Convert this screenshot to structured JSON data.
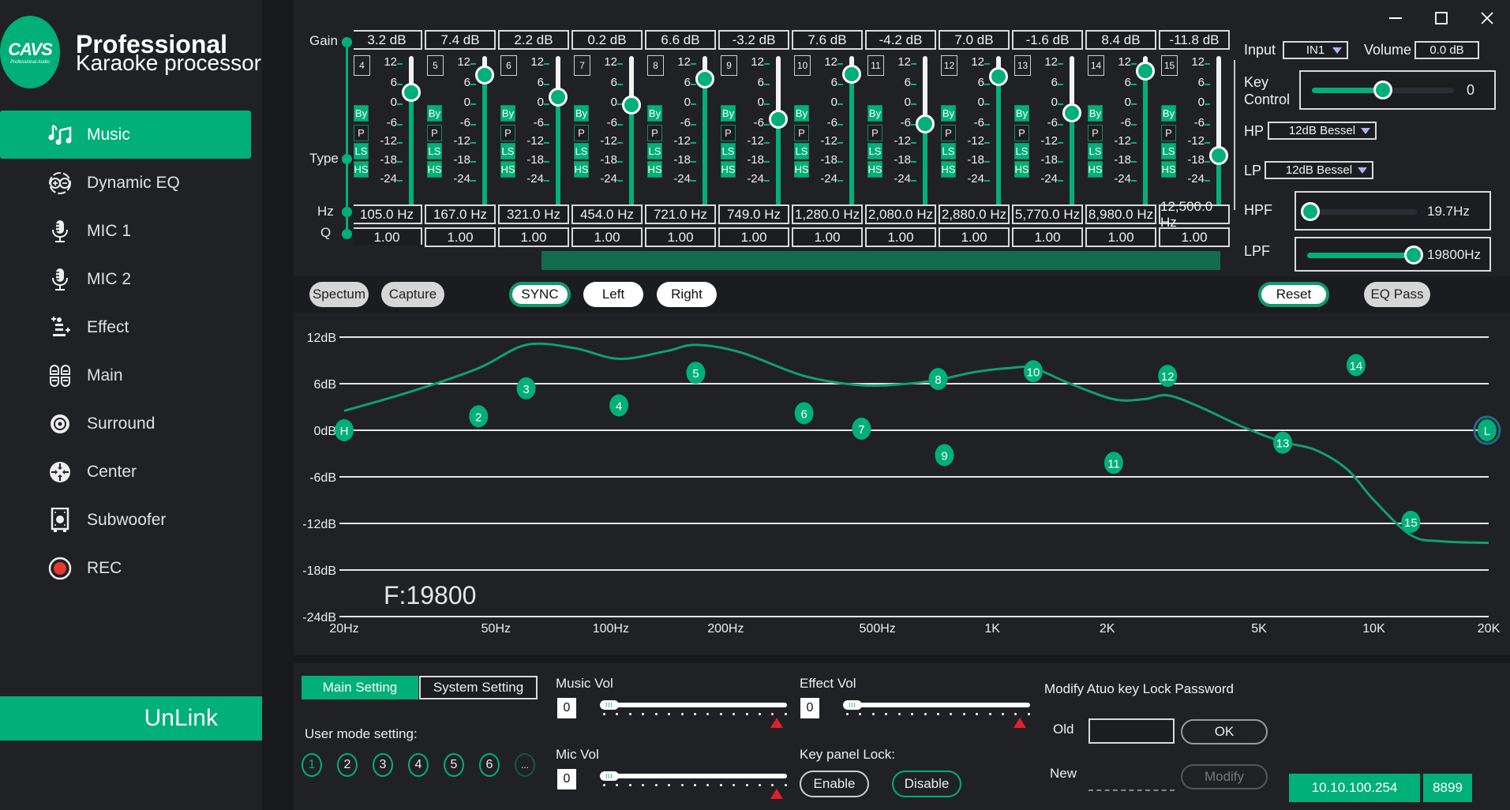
{
  "app": {
    "brand": "CAVS",
    "brand_sub": "Professional Audio",
    "title_line1": "Professional",
    "title_line2": "Karaoke processor"
  },
  "window_controls": {
    "minimize": "—",
    "maximize": "☐",
    "close": "✕"
  },
  "sidebar": {
    "items": [
      {
        "label": "Music",
        "icon": "music-notes-icon",
        "active": true
      },
      {
        "label": "Dynamic EQ",
        "icon": "dynamic-eq-icon",
        "active": false
      },
      {
        "label": "MIC 1",
        "icon": "microphone-icon",
        "active": false
      },
      {
        "label": "MIC 2",
        "icon": "microphone-icon",
        "active": false
      },
      {
        "label": "Effect",
        "icon": "effect-sparkle-icon",
        "active": false
      },
      {
        "label": "Main",
        "icon": "main-quad-icon",
        "active": false
      },
      {
        "label": "Surround",
        "icon": "speaker-surround-icon",
        "active": false
      },
      {
        "label": "Center",
        "icon": "center-arrows-icon",
        "active": false
      },
      {
        "label": "Subwoofer",
        "icon": "subwoofer-icon",
        "active": false
      },
      {
        "label": "REC",
        "icon": "record-icon",
        "active": false
      }
    ],
    "unlink_label": "UnLink"
  },
  "eq": {
    "row_labels": {
      "gain": "Gain",
      "type": "Type",
      "hz": "Hz",
      "q": "Q"
    },
    "scale_ticks": [
      "12",
      "6",
      "0",
      "-6",
      "-12",
      "-18",
      "-24"
    ],
    "type_buttons": [
      "By",
      "P",
      "LS",
      "HS"
    ],
    "bands": [
      {
        "num": "4",
        "gain": "3.2 dB",
        "gain_value": 3.2,
        "freq": "105.0 Hz",
        "q": "1.00",
        "partial": true
      },
      {
        "num": "5",
        "gain": "7.4 dB",
        "gain_value": 7.4,
        "freq": "167.0 Hz",
        "q": "1.00"
      },
      {
        "num": "6",
        "gain": "2.2 dB",
        "gain_value": 2.2,
        "freq": "321.0 Hz",
        "q": "1.00"
      },
      {
        "num": "7",
        "gain": "0.2 dB",
        "gain_value": 0.2,
        "freq": "454.0 Hz",
        "q": "1.00"
      },
      {
        "num": "8",
        "gain": "6.6 dB",
        "gain_value": 6.6,
        "freq": "721.0 Hz",
        "q": "1.00"
      },
      {
        "num": "9",
        "gain": "-3.2 dB",
        "gain_value": -3.2,
        "freq": "749.0 Hz",
        "q": "1.00"
      },
      {
        "num": "10",
        "gain": "7.6 dB",
        "gain_value": 7.6,
        "freq": "1,280.0 Hz",
        "q": "1.00"
      },
      {
        "num": "11",
        "gain": "-4.2 dB",
        "gain_value": -4.2,
        "freq": "2,080.0 Hz",
        "q": "1.00"
      },
      {
        "num": "12",
        "gain": "7.0 dB",
        "gain_value": 7.0,
        "freq": "2,880.0 Hz",
        "q": "1.00"
      },
      {
        "num": "13",
        "gain": "-1.6 dB",
        "gain_value": -1.6,
        "freq": "5,770.0 Hz",
        "q": "1.00"
      },
      {
        "num": "14",
        "gain": "8.4 dB",
        "gain_value": 8.4,
        "freq": "8,980.0 Hz",
        "q": "1.00"
      },
      {
        "num": "15",
        "gain": "-11.8 dB",
        "gain_value": -11.8,
        "freq": "12,500.0 Hz",
        "q": "1.00"
      }
    ]
  },
  "right_panel": {
    "input_label": "Input",
    "input_value": "IN1",
    "volume_label": "Volume",
    "volume_value": "0.0 dB",
    "key_control_label_1": "Key",
    "key_control_label_2": "Control",
    "key_control_value": "0",
    "key_control_fraction": 0.5,
    "hp_label": "HP",
    "hp_value": "12dB Bessel",
    "lp_label": "LP",
    "lp_value": "12dB Bessel",
    "hpf_label": "HPF",
    "hpf_value": "19.7Hz",
    "hpf_fraction": 0.0,
    "lpf_label": "LPF",
    "lpf_value": "19800Hz",
    "lpf_fraction": 1.0
  },
  "toolbar": {
    "spectrum": "Spectum",
    "capture": "Capture",
    "sync": "SYNC",
    "left": "Left",
    "right": "Right",
    "reset": "Reset",
    "eq_pass": "EQ Pass"
  },
  "chart_data": {
    "type": "line",
    "title": "",
    "xlabel": "",
    "ylabel": "",
    "x_scale": "log",
    "xlim": [
      20,
      20000
    ],
    "ylim": [
      -24,
      12
    ],
    "y_ticks": [
      12,
      6,
      0,
      -6,
      -12,
      -18,
      -24
    ],
    "y_tick_labels": [
      "12dB",
      "6dB",
      "0dB",
      "-6dB",
      "-12dB",
      "-18dB",
      "-24dB"
    ],
    "x_ticks": [
      20,
      50,
      100,
      200,
      500,
      1000,
      2000,
      5000,
      10000,
      20000
    ],
    "x_tick_labels": [
      "20Hz",
      "50Hz",
      "100Hz",
      "200Hz",
      "500Hz",
      "1K",
      "2K",
      "5K",
      "10K",
      "20K"
    ],
    "grid": true,
    "readout": "F:19800",
    "markers": [
      {
        "label": "H",
        "freq": 20,
        "gain": 0
      },
      {
        "label": "2",
        "freq": 45,
        "gain": 1.8
      },
      {
        "label": "3",
        "freq": 60,
        "gain": 5.4
      },
      {
        "label": "4",
        "freq": 105,
        "gain": 3.2
      },
      {
        "label": "5",
        "freq": 167,
        "gain": 7.4
      },
      {
        "label": "6",
        "freq": 321,
        "gain": 2.2
      },
      {
        "label": "7",
        "freq": 454,
        "gain": 0.2
      },
      {
        "label": "8",
        "freq": 721,
        "gain": 6.6
      },
      {
        "label": "9",
        "freq": 749,
        "gain": -3.2
      },
      {
        "label": "10",
        "freq": 1280,
        "gain": 7.6
      },
      {
        "label": "11",
        "freq": 2080,
        "gain": -4.2
      },
      {
        "label": "12",
        "freq": 2880,
        "gain": 7.0
      },
      {
        "label": "13",
        "freq": 5770,
        "gain": -1.6
      },
      {
        "label": "14",
        "freq": 8980,
        "gain": 8.4
      },
      {
        "label": "15",
        "freq": 12500,
        "gain": -11.8
      },
      {
        "label": "L",
        "freq": 19800,
        "gain": 0
      }
    ],
    "curve": {
      "name": "EQ response",
      "x": [
        20,
        30,
        45,
        60,
        80,
        105,
        140,
        167,
        220,
        321,
        454,
        600,
        721,
        900,
        1100,
        1280,
        1600,
        2080,
        2500,
        2880,
        3500,
        4500,
        5770,
        7000,
        8500,
        10000,
        12500,
        15000,
        20000
      ],
      "y": [
        2.5,
        5.0,
        8.0,
        11.0,
        10.6,
        9.2,
        10.2,
        11.0,
        10.0,
        7.0,
        5.8,
        6.0,
        6.5,
        7.5,
        8.0,
        8.0,
        6.0,
        4.0,
        4.0,
        4.5,
        3.0,
        0.5,
        -1.5,
        -2.5,
        -5.0,
        -9.0,
        -13.5,
        -14.3,
        -14.5
      ]
    }
  },
  "bottom": {
    "tab_main": "Main Setting",
    "tab_system": "System Setting",
    "user_mode_label": "User mode setting:",
    "modes": [
      "1",
      "2",
      "3",
      "4",
      "5",
      "6",
      "..."
    ],
    "music_vol_label": "Music Vol",
    "music_vol_value": "0",
    "mic_vol_label": "Mic Vol",
    "mic_vol_value": "0",
    "effect_vol_label": "Effect Vol",
    "effect_vol_value": "0",
    "knob_grip": "III",
    "key_panel_lock_label": "Key panel Lock:",
    "enable_label": "Enable",
    "disable_label": "Disable",
    "password_title": "Modify Atuo key Lock Password",
    "old_label": "Old",
    "new_label": "New",
    "ok_label": "OK",
    "modify_label": "Modify",
    "ip_address": "10.10.100.254",
    "port": "8899"
  },
  "colors": {
    "accent": "#00b077",
    "background": "#202125",
    "dark_bar": "#136b4d",
    "rec_red": "#e8392e",
    "marker_triangle": "#e0202a"
  }
}
